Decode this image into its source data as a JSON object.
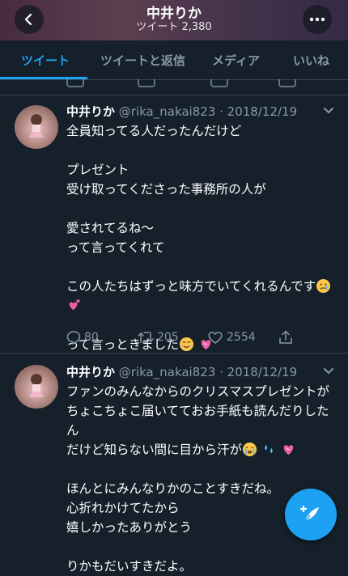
{
  "header": {
    "title": "中井りか",
    "subtitle": "ツイート 2,380"
  },
  "tabs": [
    {
      "label": "ツイート",
      "active": true
    },
    {
      "label": "ツイートと返信",
      "active": false
    },
    {
      "label": "メディア",
      "active": false
    },
    {
      "label": "いいね",
      "active": false
    }
  ],
  "tweets": [
    {
      "name": "中井りか",
      "handle": "@rika_nakai823",
      "date": "· 2018/12/19",
      "lines": [
        "全員知ってる人だったんだけど",
        "",
        "プレゼント",
        "受け取ってくださった事務所の人が",
        "",
        "愛されてるね〜",
        "って言ってくれて",
        "",
        "この人たちはずっと味方でいてくれるんです",
        "",
        "",
        "って言っときました"
      ],
      "replies": "80",
      "retweets": "205",
      "likes": "2554"
    },
    {
      "name": "中井りか",
      "handle": "@rika_nakai823",
      "date": "· 2018/12/19",
      "lines": [
        "ファンのみんなからのクリスマスプレゼントが",
        "ちょこちょこ届いてておお手紙も読んだりしたん",
        "だけど知らない間に目から汗が",
        "",
        "ほんとにみんなりかのことすきだね。",
        "心折れかけてたから",
        "嬉しかったありがとう",
        "",
        "りかもだいすきだよ。"
      ]
    }
  ],
  "colors": {
    "background": "#15202b",
    "accent": "#1da1f2",
    "muted": "#8899a6",
    "divider": "#38444d"
  },
  "icons": [
    "back-arrow-icon",
    "more-dots-icon",
    "chevron-down-icon",
    "reply-icon",
    "retweet-icon",
    "like-icon",
    "share-icon",
    "compose-icon"
  ]
}
